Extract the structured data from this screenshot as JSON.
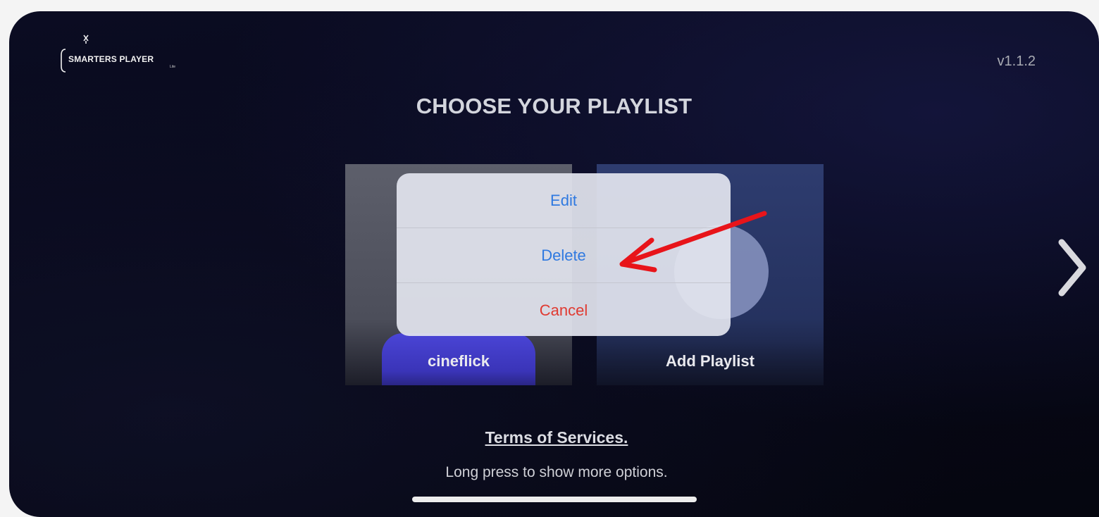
{
  "app": {
    "logo_text": "SMARTERS PLAYER",
    "logo_sub": "Lite",
    "version": "v1.1.2"
  },
  "page": {
    "title": "CHOOSE YOUR PLAYLIST"
  },
  "playlists": [
    {
      "label": "cineflick"
    },
    {
      "label": "Add Playlist"
    }
  ],
  "action_sheet": {
    "edit_label": "Edit",
    "delete_label": "Delete",
    "cancel_label": "Cancel"
  },
  "footer": {
    "terms_label": "Terms of Services.",
    "hint": "Long press to show more options."
  },
  "icons": {
    "next": "chevron-right-icon",
    "annotation": "red-arrow-icon",
    "logo": "tv-antenna-icon"
  },
  "colors": {
    "action_blue": "#2f79e0",
    "cancel_red": "#e03a31",
    "annotation_red": "#e8141a",
    "background": "#07081a"
  }
}
